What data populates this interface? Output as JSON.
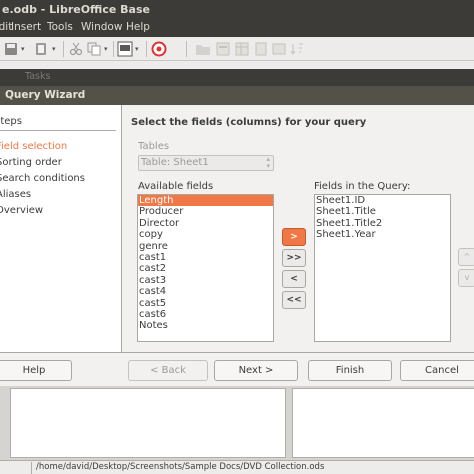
{
  "window": {
    "title": "e.odb - LibreOffice Base"
  },
  "menu": [
    "Edit",
    "Insert",
    "Tools",
    "Window",
    "Help"
  ],
  "toolbar": {
    "icons": [
      "save-icon",
      "clipboard-icon",
      "print-icon",
      "form-icon",
      "help-icon"
    ]
  },
  "tasks_label": "Tasks",
  "dialog": {
    "title": "Query Wizard",
    "steps_header": "Steps",
    "steps": [
      "Field selection",
      "Sorting order",
      "Search conditions",
      "Aliases",
      "Overview"
    ],
    "heading": "Select the fields (columns) for your query",
    "tables_label": "Tables",
    "table_value": "Table: Sheet1",
    "available_label": "Available fields",
    "available_fields": [
      "Length",
      "Producer",
      "Director",
      "copy",
      "genre",
      "cast1",
      "cast2",
      "cast3",
      "cast4",
      "cast5",
      "cast6",
      "Notes"
    ],
    "selected_available": 0,
    "query_label": "Fields in the Query:",
    "query_fields": [
      "Sheet1.ID",
      "Sheet1.Title",
      "Sheet1.Title2",
      "Sheet1.Year"
    ],
    "move_buttons": [
      ">",
      ">>",
      "<",
      "<<"
    ],
    "side_buttons": [
      "^",
      "v"
    ]
  },
  "buttons": {
    "help": "Help",
    "back": "< Back",
    "next": "Next >",
    "finish": "Finish",
    "cancel": "Cancel"
  },
  "status": {
    "path": "/home/david/Desktop/Screenshots/Sample Docs/DVD Collection.ods"
  }
}
